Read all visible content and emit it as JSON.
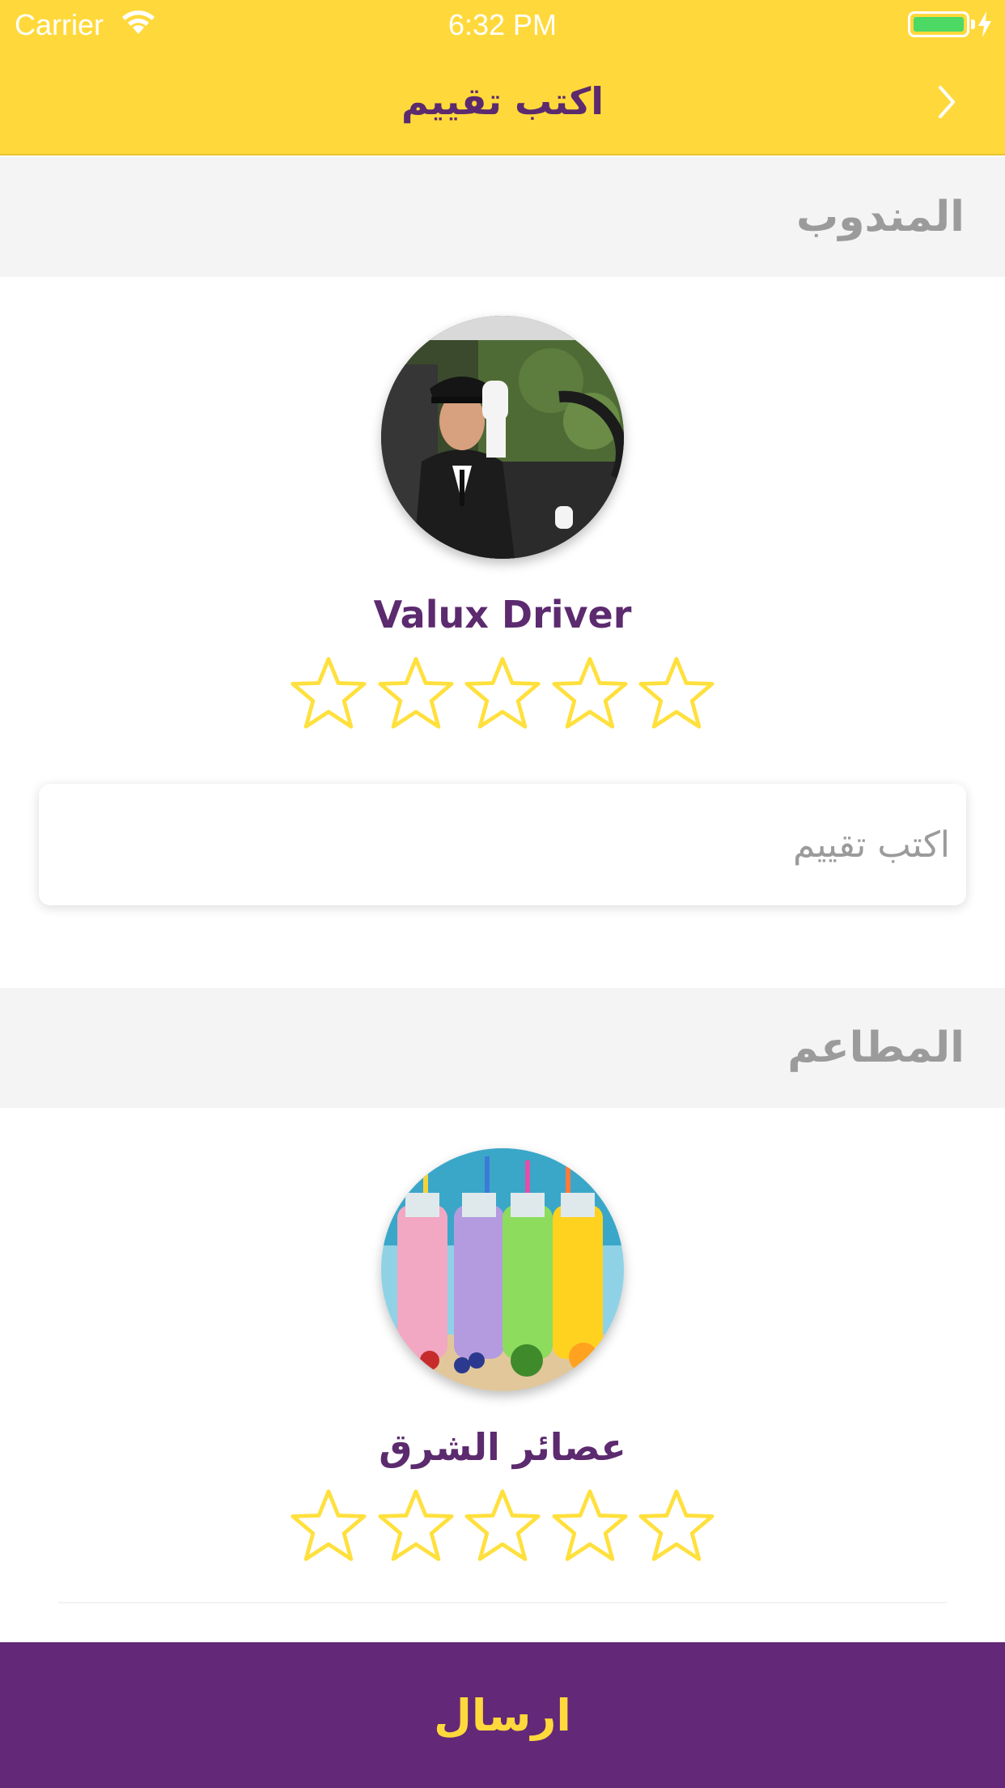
{
  "status_bar": {
    "carrier": "Carrier",
    "time": "6:32 PM",
    "battery_color": "#4CD964"
  },
  "nav": {
    "title": "اكتب تقييم",
    "back_icon": "chevron-right-icon"
  },
  "driver_section": {
    "header": "المندوب",
    "name": "Valux Driver",
    "avatar_icon": "driver-photo",
    "rating": 0,
    "max_rating": 5,
    "review_placeholder": "اكتب تقييم"
  },
  "restaurant_section": {
    "header": "المطاعم",
    "name": "عصائر الشرق",
    "avatar_icon": "juice-bottles-photo",
    "rating": 0,
    "max_rating": 5
  },
  "submit": {
    "label": "ارسال"
  },
  "colors": {
    "brand_yellow": "#FFD93B",
    "brand_purple": "#632878",
    "title_purple": "#5c2a6e",
    "section_bg": "#f4f4f4",
    "section_text": "#9b9b9b",
    "star_yellow": "#FFE03D"
  }
}
